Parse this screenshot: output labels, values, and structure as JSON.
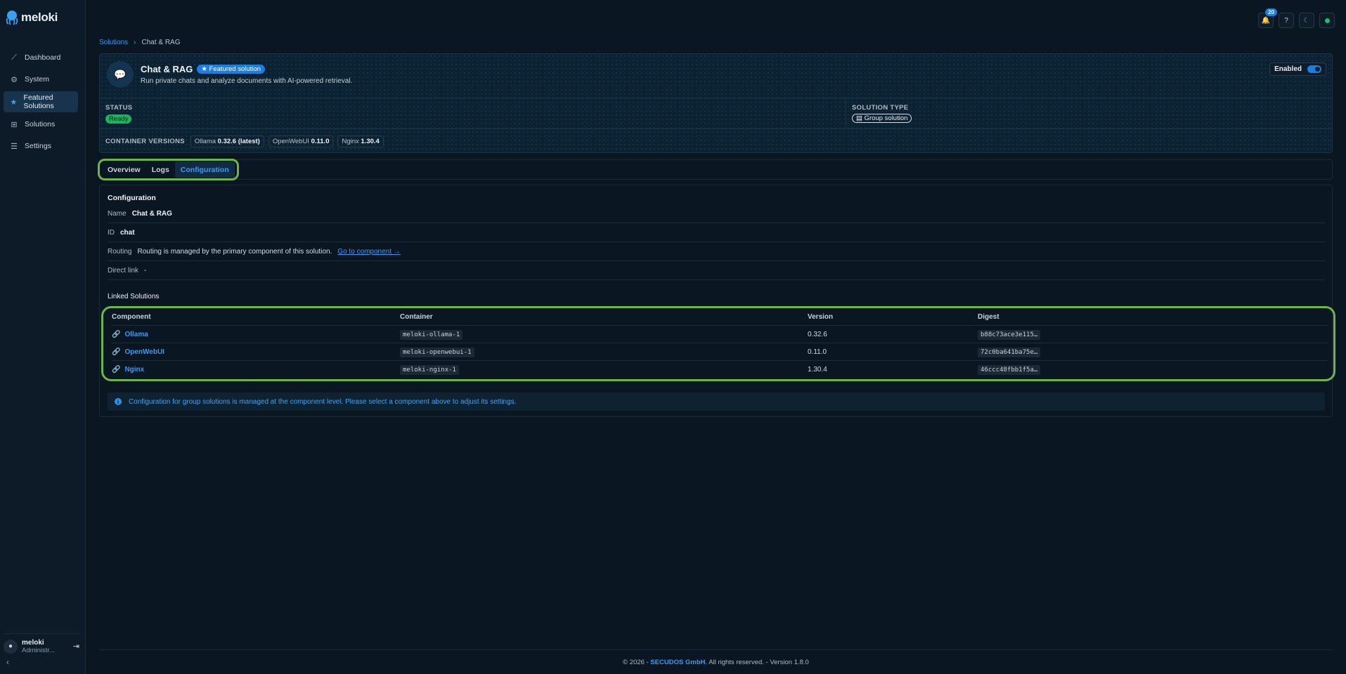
{
  "app": {
    "name": "meloki"
  },
  "sidebar": {
    "items": [
      {
        "label": "Dashboard",
        "icon": "chart-line-icon"
      },
      {
        "label": "System",
        "icon": "gear-icon"
      },
      {
        "label": "Featured Solutions",
        "icon": "star-icon",
        "active": true
      },
      {
        "label": "Solutions",
        "icon": "grid-icon"
      },
      {
        "label": "Settings",
        "icon": "sliders-icon"
      }
    ],
    "user": {
      "name": "meloki",
      "role": "Administr..."
    }
  },
  "topbar": {
    "notification_count": "20"
  },
  "breadcrumb": {
    "parent": "Solutions",
    "current": "Chat & RAG"
  },
  "solution": {
    "title": "Chat & RAG",
    "badge": "Featured solution",
    "description": "Run private chats and analyze documents with AI-powered retrieval.",
    "enabled_label": "Enabled",
    "status_label": "STATUS",
    "status_value": "Ready",
    "type_label": "SOLUTION TYPE",
    "type_value": "Group solution",
    "versions_label": "CONTAINER VERSIONS",
    "versions": [
      {
        "name": "Ollama",
        "version": "0.32.6 (latest)"
      },
      {
        "name": "OpenWebUI",
        "version": "0.11.0"
      },
      {
        "name": "Nginx",
        "version": "1.30.4"
      }
    ]
  },
  "tabs": [
    {
      "label": "Overview"
    },
    {
      "label": "Logs"
    },
    {
      "label": "Configuration",
      "active": true
    }
  ],
  "config": {
    "title": "Configuration",
    "name_label": "Name",
    "name_value": "Chat & RAG",
    "id_label": "ID",
    "id_value": "chat",
    "routing_label": "Routing",
    "routing_text": "Routing is managed by the primary component of this solution.",
    "routing_link": "Go to component →",
    "direct_label": "Direct link",
    "direct_value": "-",
    "linked_title": "Linked Solutions",
    "columns": [
      "Component",
      "Container",
      "Version",
      "Digest"
    ],
    "rows": [
      {
        "component": "Ollama",
        "container": "meloki-ollama-1",
        "version": "0.32.6",
        "digest": "b88c73ace3e115…"
      },
      {
        "component": "OpenWebUI",
        "container": "meloki-openwebui-1",
        "version": "0.11.0",
        "digest": "72c0ba641ba75e…"
      },
      {
        "component": "Nginx",
        "container": "meloki-nginx-1",
        "version": "1.30.4",
        "digest": "46ccc48fbb1f5a…"
      }
    ],
    "info": "Configuration for group solutions is managed at the component level. Please select a component above to adjust its settings."
  },
  "footer": {
    "prefix": "© 2026 -",
    "brand": "SECUDOS GmbH",
    "suffix": ". All rights reserved. - Version 1.8.0"
  }
}
